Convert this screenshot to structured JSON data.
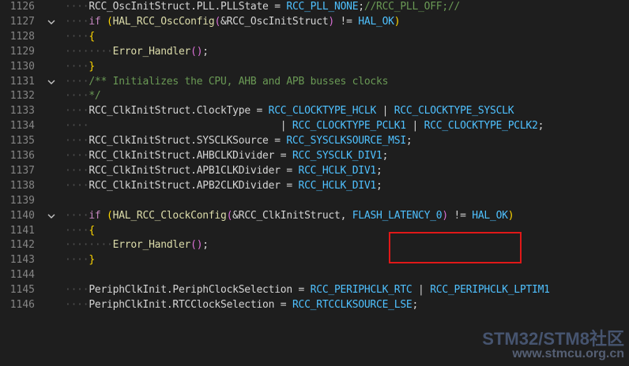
{
  "editor": {
    "lines": [
      {
        "num": "1126",
        "fold": "",
        "indent": 2,
        "tokens": [
          {
            "t": "RCC_OscInitStruct",
            "c": "id"
          },
          {
            "t": ".",
            "c": "pun"
          },
          {
            "t": "PLL",
            "c": "id"
          },
          {
            "t": ".",
            "c": "pun"
          },
          {
            "t": "PLLState",
            "c": "id"
          },
          {
            "t": " = ",
            "c": "op"
          },
          {
            "t": "RCC_PLL_NONE",
            "c": "mac"
          },
          {
            "t": ";",
            "c": "pun"
          },
          {
            "t": "//RCC_PLL_OFF;//",
            "c": "cm"
          }
        ]
      },
      {
        "num": "1127",
        "fold": "v",
        "indent": 2,
        "tokens": [
          {
            "t": "if",
            "c": "kw"
          },
          {
            "t": " ",
            "c": "op"
          },
          {
            "t": "(",
            "c": "p1"
          },
          {
            "t": "HAL_RCC_OscConfig",
            "c": "fn"
          },
          {
            "t": "(",
            "c": "p2"
          },
          {
            "t": "&RCC_OscInitStruct",
            "c": "id"
          },
          {
            "t": ")",
            "c": "p2"
          },
          {
            "t": " != ",
            "c": "op"
          },
          {
            "t": "HAL_OK",
            "c": "mac"
          },
          {
            "t": ")",
            "c": "p1"
          }
        ]
      },
      {
        "num": "1128",
        "fold": "",
        "indent": 2,
        "tokens": [
          {
            "t": "{",
            "c": "p1"
          }
        ]
      },
      {
        "num": "1129",
        "fold": "",
        "indent": 4,
        "tokens": [
          {
            "t": "Error_Handler",
            "c": "fn"
          },
          {
            "t": "()",
            "c": "p2"
          },
          {
            "t": ";",
            "c": "pun"
          }
        ]
      },
      {
        "num": "1130",
        "fold": "",
        "indent": 2,
        "tokens": [
          {
            "t": "}",
            "c": "p1"
          }
        ]
      },
      {
        "num": "1131",
        "fold": "v",
        "indent": 2,
        "tokens": [
          {
            "t": "/** Initializes the CPU, AHB and APB busses clocks",
            "c": "cm"
          }
        ]
      },
      {
        "num": "1132",
        "fold": "",
        "indent": 2,
        "tokens": [
          {
            "t": "*/",
            "c": "cm"
          }
        ]
      },
      {
        "num": "1133",
        "fold": "",
        "indent": 2,
        "tokens": [
          {
            "t": "RCC_ClkInitStruct",
            "c": "id"
          },
          {
            "t": ".",
            "c": "pun"
          },
          {
            "t": "ClockType",
            "c": "id"
          },
          {
            "t": " = ",
            "c": "op"
          },
          {
            "t": "RCC_CLOCKTYPE_HCLK",
            "c": "mac"
          },
          {
            "t": " | ",
            "c": "op"
          },
          {
            "t": "RCC_CLOCKTYPE_SYSCLK",
            "c": "mac"
          }
        ]
      },
      {
        "num": "1134",
        "fold": "",
        "indent": 2,
        "pre": "                                | ",
        "tokens": [
          {
            "t": "RCC_CLOCKTYPE_PCLK1",
            "c": "mac"
          },
          {
            "t": " | ",
            "c": "op"
          },
          {
            "t": "RCC_CLOCKTYPE_PCLK2",
            "c": "mac"
          },
          {
            "t": ";",
            "c": "pun"
          }
        ]
      },
      {
        "num": "1135",
        "fold": "",
        "indent": 2,
        "tokens": [
          {
            "t": "RCC_ClkInitStruct",
            "c": "id"
          },
          {
            "t": ".",
            "c": "pun"
          },
          {
            "t": "SYSCLKSource",
            "c": "id"
          },
          {
            "t": " = ",
            "c": "op"
          },
          {
            "t": "RCC_SYSCLKSOURCE_MSI",
            "c": "mac"
          },
          {
            "t": ";",
            "c": "pun"
          }
        ]
      },
      {
        "num": "1136",
        "fold": "",
        "indent": 2,
        "tokens": [
          {
            "t": "RCC_ClkInitStruct",
            "c": "id"
          },
          {
            "t": ".",
            "c": "pun"
          },
          {
            "t": "AHBCLKDivider",
            "c": "id"
          },
          {
            "t": " = ",
            "c": "op"
          },
          {
            "t": "RCC_SYSCLK_DIV1",
            "c": "mac"
          },
          {
            "t": ";",
            "c": "pun"
          }
        ]
      },
      {
        "num": "1137",
        "fold": "",
        "indent": 2,
        "tokens": [
          {
            "t": "RCC_ClkInitStruct",
            "c": "id"
          },
          {
            "t": ".",
            "c": "pun"
          },
          {
            "t": "APB1CLKDivider",
            "c": "id"
          },
          {
            "t": " = ",
            "c": "op"
          },
          {
            "t": "RCC_HCLK_DIV1",
            "c": "mac"
          },
          {
            "t": ";",
            "c": "pun"
          }
        ]
      },
      {
        "num": "1138",
        "fold": "",
        "indent": 2,
        "tokens": [
          {
            "t": "RCC_ClkInitStruct",
            "c": "id"
          },
          {
            "t": ".",
            "c": "pun"
          },
          {
            "t": "APB2CLKDivider",
            "c": "id"
          },
          {
            "t": " = ",
            "c": "op"
          },
          {
            "t": "RCC_HCLK_DIV1",
            "c": "mac"
          },
          {
            "t": ";",
            "c": "pun"
          }
        ]
      },
      {
        "num": "1139",
        "fold": "",
        "indent": 0,
        "tokens": []
      },
      {
        "num": "1140",
        "fold": "v",
        "indent": 2,
        "tokens": [
          {
            "t": "if",
            "c": "kw"
          },
          {
            "t": " ",
            "c": "op"
          },
          {
            "t": "(",
            "c": "p1"
          },
          {
            "t": "HAL_RCC_ClockConfig",
            "c": "fn"
          },
          {
            "t": "(",
            "c": "p2"
          },
          {
            "t": "&RCC_ClkInitStruct",
            "c": "id"
          },
          {
            "t": ", ",
            "c": "pun"
          },
          {
            "t": "FLASH_LATENCY_0",
            "c": "mac"
          },
          {
            "t": ")",
            "c": "p2"
          },
          {
            "t": " != ",
            "c": "op"
          },
          {
            "t": "HAL_OK",
            "c": "mac"
          },
          {
            "t": ")",
            "c": "p1"
          }
        ]
      },
      {
        "num": "1141",
        "fold": "",
        "indent": 2,
        "tokens": [
          {
            "t": "{",
            "c": "p1"
          }
        ]
      },
      {
        "num": "1142",
        "fold": "",
        "indent": 4,
        "tokens": [
          {
            "t": "Error_Handler",
            "c": "fn"
          },
          {
            "t": "()",
            "c": "p2"
          },
          {
            "t": ";",
            "c": "pun"
          }
        ]
      },
      {
        "num": "1143",
        "fold": "",
        "indent": 2,
        "tokens": [
          {
            "t": "}",
            "c": "p1"
          }
        ]
      },
      {
        "num": "1144",
        "fold": "",
        "indent": 0,
        "tokens": []
      },
      {
        "num": "1145",
        "fold": "",
        "indent": 2,
        "tokens": [
          {
            "t": "PeriphClkInit",
            "c": "id"
          },
          {
            "t": ".",
            "c": "pun"
          },
          {
            "t": "PeriphClockSelection",
            "c": "id"
          },
          {
            "t": " = ",
            "c": "op"
          },
          {
            "t": "RCC_PERIPHCLK_RTC",
            "c": "mac"
          },
          {
            "t": " | ",
            "c": "op"
          },
          {
            "t": "RCC_PERIPHCLK_LPTIM1",
            "c": "mac"
          }
        ]
      },
      {
        "num": "1146",
        "fold": "",
        "indent": 2,
        "tokens": [
          {
            "t": "PeriphClkInit",
            "c": "id"
          },
          {
            "t": ".",
            "c": "pun"
          },
          {
            "t": "RTCClockSelection",
            "c": "id"
          },
          {
            "t": " = ",
            "c": "op"
          },
          {
            "t": "RCC_RTCCLKSOURCE_LSE",
            "c": "mac"
          },
          {
            "t": ";",
            "c": "pun"
          }
        ]
      }
    ]
  },
  "watermark": {
    "line1": "STM32/STM8社区",
    "line2": "www.stmcu.org.cn"
  },
  "colors": {
    "background": "#1e1e1e",
    "keyword": "#c586c0",
    "function": "#dcdcaa",
    "macro": "#4fc1ff",
    "comment": "#6a9955",
    "highlight": "#e01818"
  },
  "icons": {
    "fold": "chevron-down-icon"
  }
}
